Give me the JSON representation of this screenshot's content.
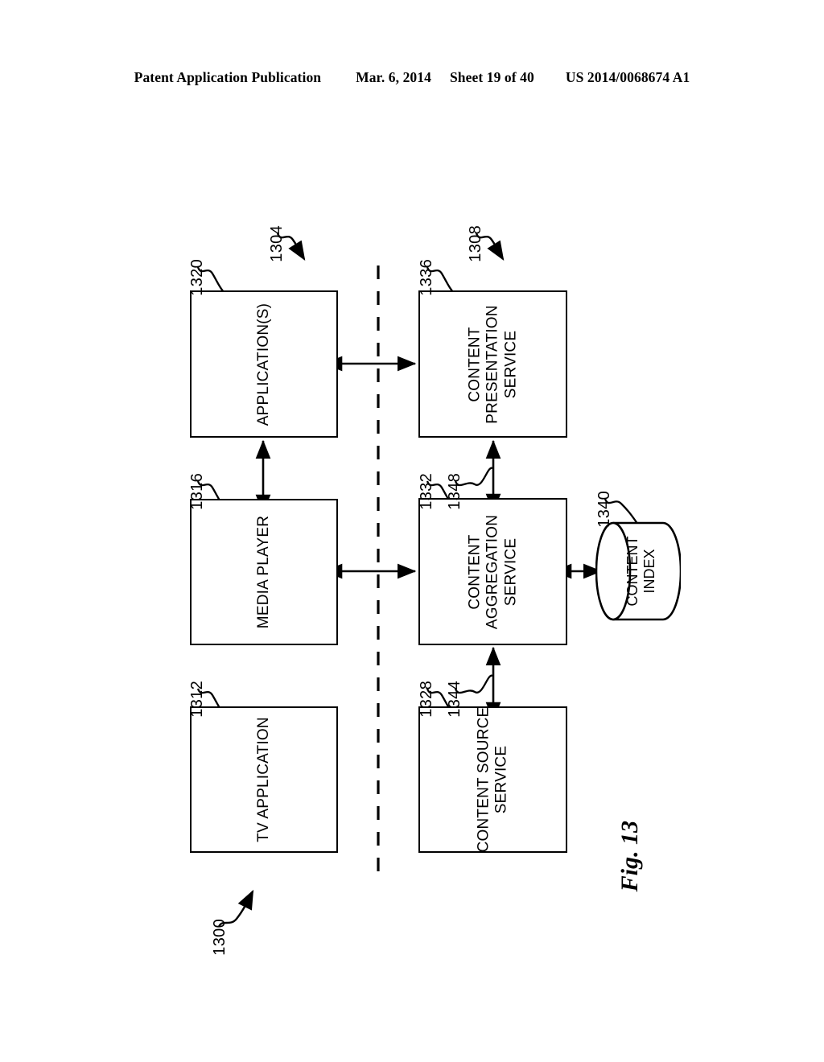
{
  "header": {
    "publication": "Patent Application Publication",
    "date": "Mar. 6, 2014",
    "sheet": "Sheet 19 of 40",
    "pub_number": "US 2014/0068674 A1"
  },
  "figure": {
    "caption": "Fig. 13",
    "overall_ref": "1300",
    "client_group_ref": "1304",
    "server_group_ref": "1308"
  },
  "nodes": {
    "tv_application": {
      "label": "TV APPLICATION",
      "ref": "1312"
    },
    "media_player": {
      "label": "MEDIA PLAYER",
      "ref": "1316"
    },
    "applications": {
      "label": "APPLICATION(S)",
      "ref": "1320"
    },
    "content_source_service": {
      "label": "CONTENT SOURCE\nSERVICE",
      "ref": "1328"
    },
    "content_aggregation_service": {
      "label": "CONTENT\nAGGREGATION\nSERVICE",
      "ref": "1332"
    },
    "content_presentation_service": {
      "label": "CONTENT\nPRESENTATION\nSERVICE",
      "ref": "1336"
    },
    "content_index": {
      "label": "CONTENT\nINDEX",
      "ref": "1340"
    }
  },
  "connector_refs": {
    "source_to_aggregation": "1344",
    "aggregation_to_presentation": "1348"
  },
  "colors": {
    "ink": "#000000",
    "paper": "#ffffff"
  }
}
